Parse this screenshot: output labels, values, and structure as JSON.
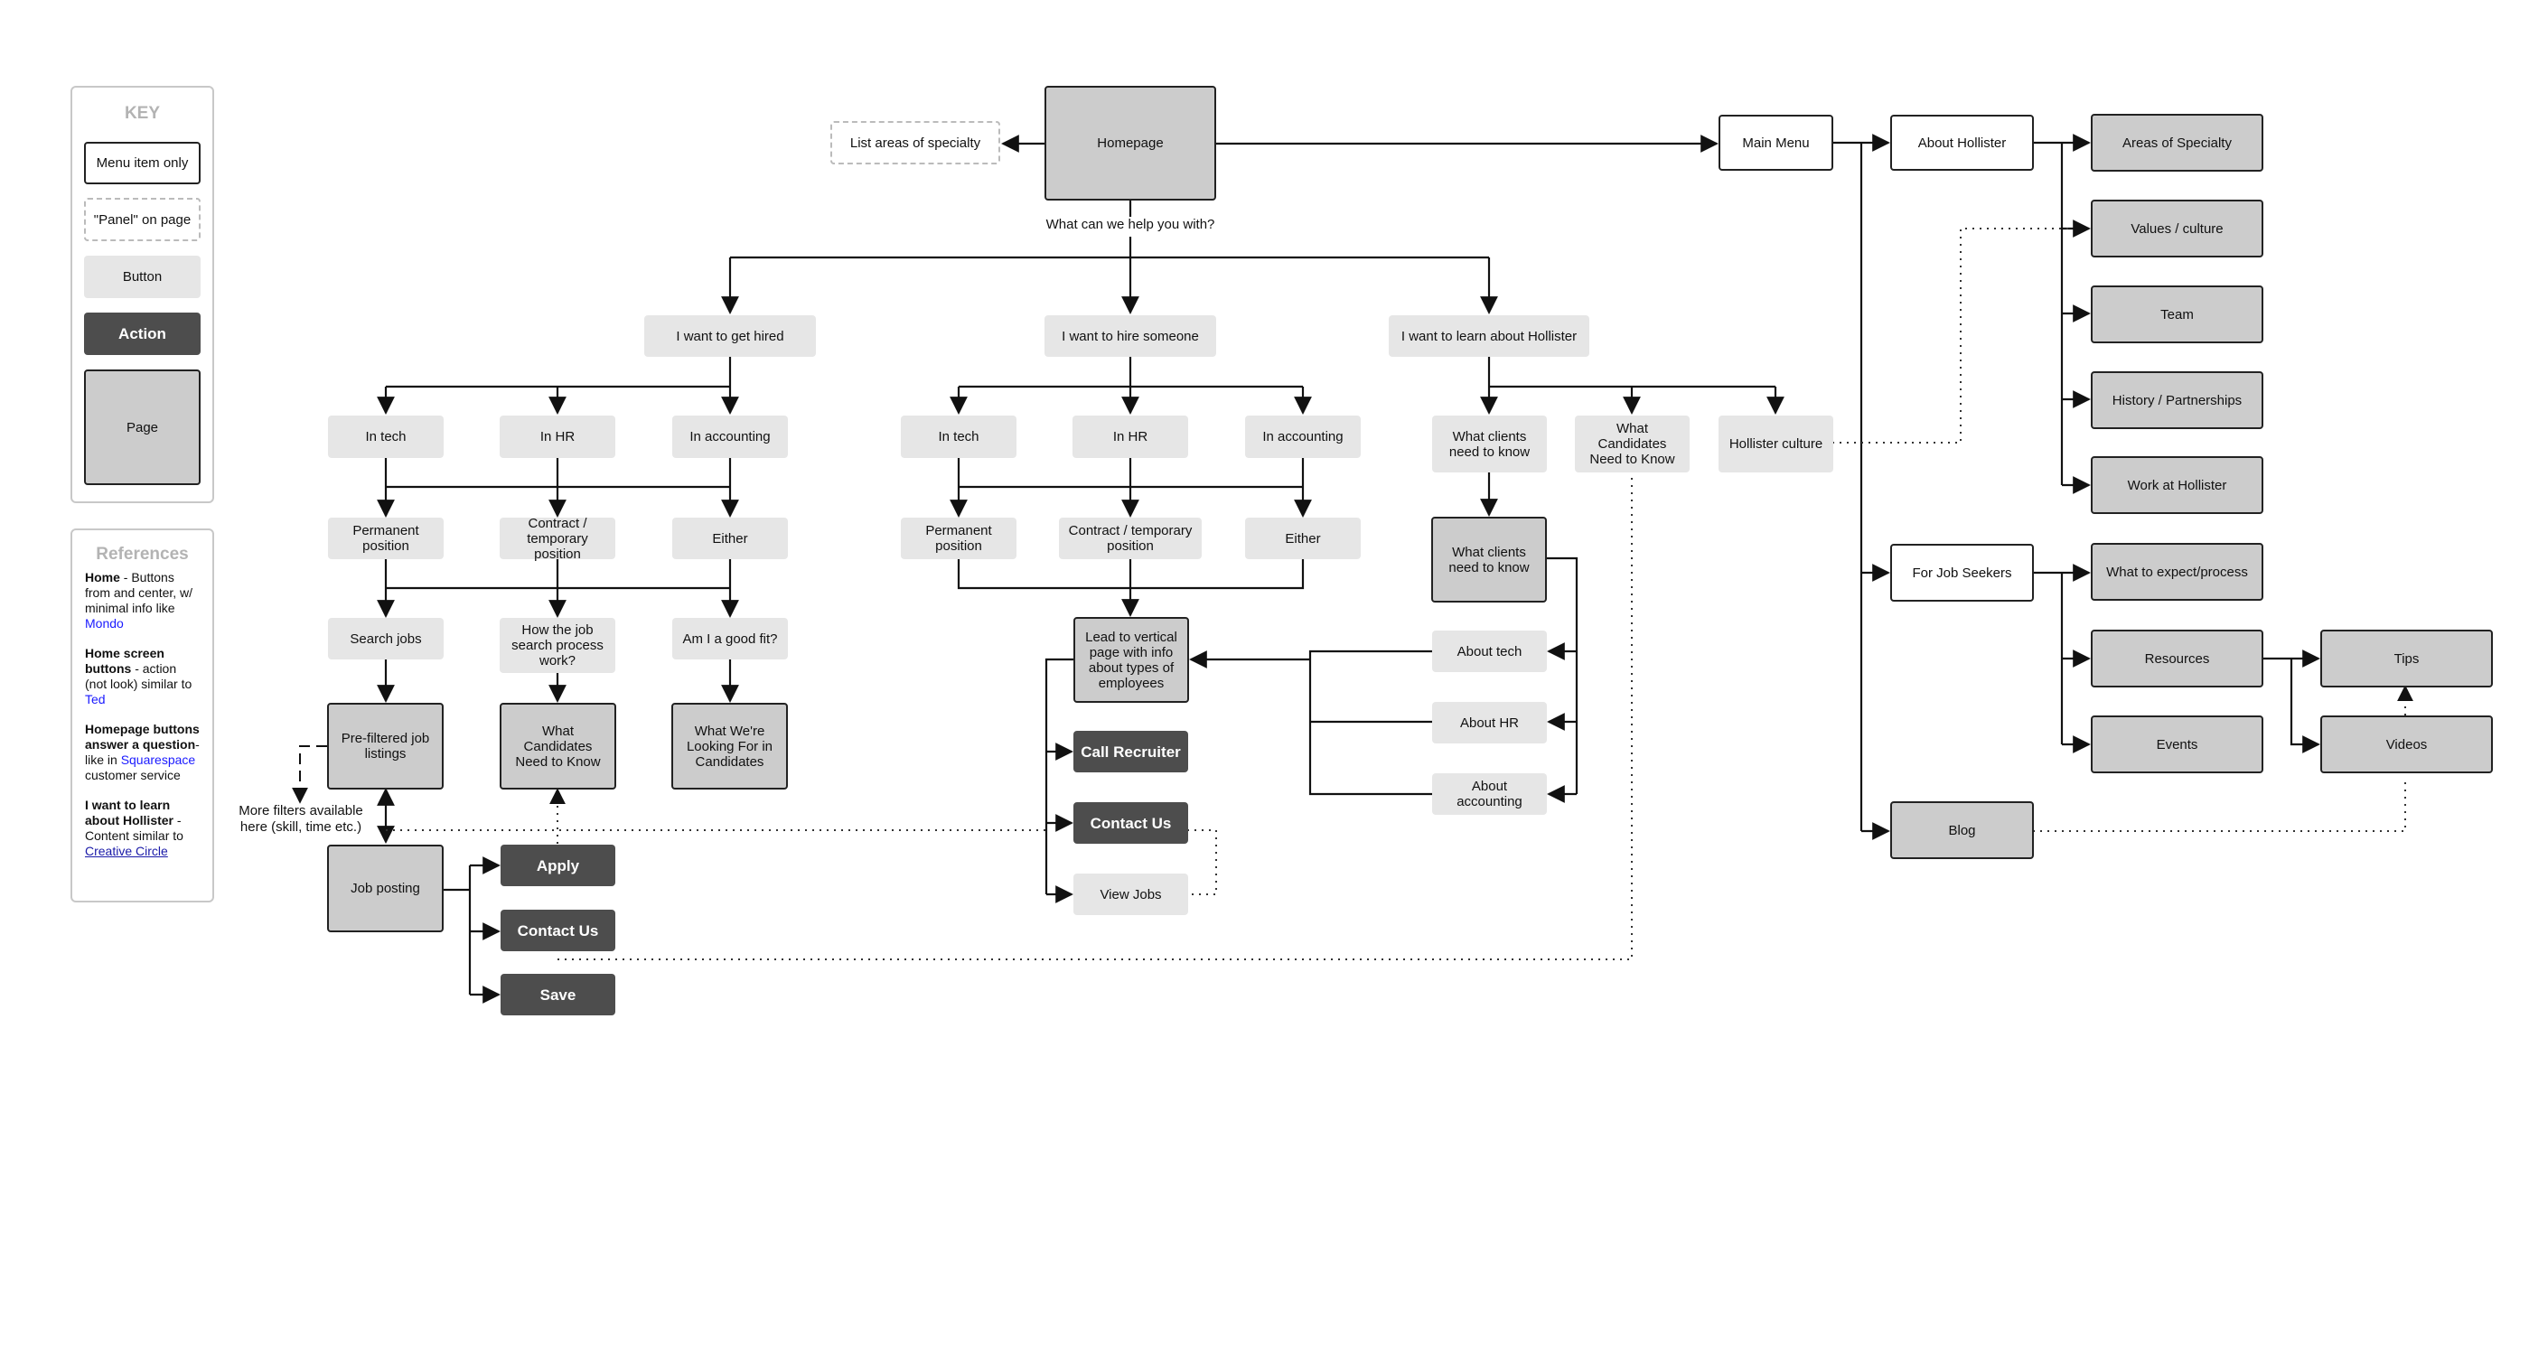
{
  "key": {
    "title": "KEY",
    "items": [
      {
        "type": "menu",
        "label": "Menu item only"
      },
      {
        "type": "panel",
        "label": "\"Panel\" on page"
      },
      {
        "type": "button",
        "label": "Button"
      },
      {
        "type": "action",
        "label": "Action"
      },
      {
        "type": "page",
        "label": "Page"
      }
    ]
  },
  "references": {
    "title": "References",
    "entries": [
      {
        "bold": "Home",
        "text": " - Buttons from and center, w/ minimal info like ",
        "link": "Mondo",
        "after": ""
      },
      {
        "bold": "Home screen buttons",
        "text": " - action (not look) similar to ",
        "link": "Ted",
        "after": ""
      },
      {
        "bold": "Homepage buttons answer a question",
        "text": "- like in ",
        "link": "Squarespace",
        "after": " customer service"
      },
      {
        "bold": "I want to learn about Hollister",
        "text": " - Content similar to ",
        "link": "Creative Circle",
        "after": ""
      }
    ]
  },
  "diagram": {
    "homepage": "Homepage",
    "list_areas": "List areas of specialty",
    "question": "What can we help you with?",
    "get_hired": {
      "root": "I want to get hired",
      "fields": [
        "In tech",
        "In HR",
        "In accounting"
      ],
      "positions": [
        "Permanent position",
        "Contract / temporary position",
        "Either"
      ],
      "questions": [
        "Search jobs",
        "How the job search process work?",
        "Am I a good fit?"
      ],
      "pages": [
        "Pre-filtered job listings",
        "What Candidates Need to Know",
        "What We're Looking For in Candidates"
      ],
      "filters_note": "More filters available here (skill, time etc.)",
      "job_posting": "Job posting",
      "actions": [
        "Apply",
        "Contact Us",
        "Save"
      ]
    },
    "hire": {
      "root": "I want to hire someone",
      "fields": [
        "In tech",
        "In HR",
        "In accounting"
      ],
      "positions": [
        "Permanent position",
        "Contract / temporary position",
        "Either"
      ],
      "vertical_page": "Lead to vertical page with info about types of employees",
      "actions": [
        "Call Recruiter",
        "Contact Us"
      ],
      "view_jobs": "View Jobs"
    },
    "learn": {
      "root": "I want to learn about Hollister",
      "children": [
        "What clients need to know",
        "What Candidates Need to Know",
        "Hollister culture"
      ],
      "clients_page": "What clients need to know",
      "about": [
        "About tech",
        "About HR",
        "About accounting"
      ]
    },
    "menu": {
      "main": "Main Menu",
      "about": "About Hollister",
      "about_pages": [
        "Areas of Specialty",
        "Values / culture",
        "Team",
        "History / Partnerships",
        "Work at Hollister"
      ],
      "job_seekers": "For Job Seekers",
      "job_seeker_pages": [
        "What to expect/process",
        "Resources",
        "Events"
      ],
      "resources_pages": [
        "Tips",
        "Videos"
      ],
      "blog": "Blog"
    }
  }
}
